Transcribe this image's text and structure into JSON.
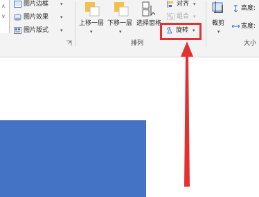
{
  "colors": {
    "ribbon_bg": "#f3f3f3",
    "highlight_box": "#e53030",
    "arrow": "#e53030",
    "shape_fill": "#4472c4"
  },
  "picture_styles": {
    "border_label": "图片边框",
    "effects_label": "图片效果",
    "layout_label": "图片版式"
  },
  "arrange": {
    "bring_forward_label": "上移一层",
    "send_backward_label": "下移一层",
    "selection_pane_label": "选择窗格",
    "align_label": "对齐",
    "group_label": "组合",
    "rotate_label": "旋转",
    "group_title": "排列"
  },
  "size": {
    "crop_label": "裁剪",
    "height_label": "高度:",
    "width_label": "宽度:",
    "group_title": "大小"
  },
  "icons": {
    "dialog_launcher": "dialog-launcher-icon",
    "caret": "▾"
  }
}
